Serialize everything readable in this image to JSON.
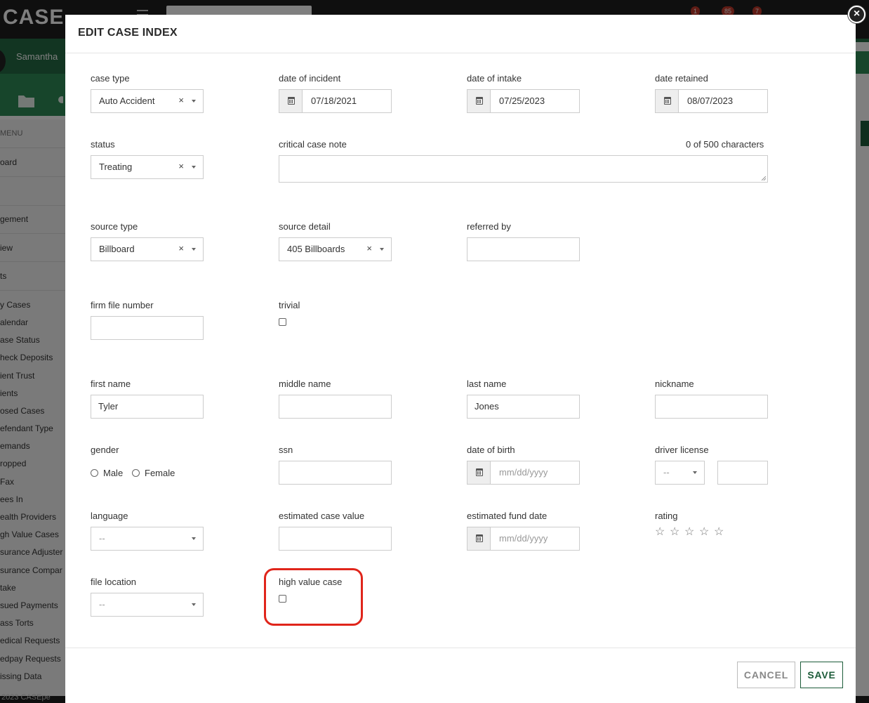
{
  "background": {
    "logo": "CASE",
    "user_name": "Samantha",
    "badges": [
      "1",
      "85",
      "7"
    ],
    "sidebar_menu_label": "MENU",
    "sidebar_items": [
      "oard",
      "gement",
      "iew",
      "ts",
      "y Cases",
      "alendar",
      "ase Status",
      "heck Deposits",
      "ient Trust",
      "ients",
      "osed Cases",
      "efendant Type",
      "emands",
      "ropped",
      "Fax",
      "ees In",
      "ealth Providers",
      "gh Value Cases",
      "surance Adjuster",
      "surance Compar",
      "take",
      "sued Payments",
      "ass Torts",
      "edical Requests",
      "edpay Requests",
      "issing Data"
    ],
    "footer_text": "2023 CASEpe"
  },
  "modal": {
    "title": "EDIT CASE INDEX",
    "close_symbol": "×",
    "fields": {
      "case_type": {
        "label": "case type",
        "value": "Auto Accident",
        "clear": "×"
      },
      "date_of_incident": {
        "label": "date of incident",
        "value": "07/18/2021"
      },
      "date_of_intake": {
        "label": "date of intake",
        "value": "07/25/2023"
      },
      "date_retained": {
        "label": "date retained",
        "value": "08/07/2023"
      },
      "status": {
        "label": "status",
        "value": "Treating",
        "clear": "×"
      },
      "critical_case_note": {
        "label": "critical case note",
        "counter": "0 of 500 characters",
        "value": ""
      },
      "source_type": {
        "label": "source type",
        "value": "Billboard",
        "clear": "×"
      },
      "source_detail": {
        "label": "source detail",
        "value": "405 Billboards",
        "clear": "×"
      },
      "referred_by": {
        "label": "referred by",
        "value": ""
      },
      "firm_file_number": {
        "label": "firm file number",
        "value": ""
      },
      "trivial": {
        "label": "trivial",
        "checked": false
      },
      "first_name": {
        "label": "first name",
        "value": "Tyler"
      },
      "middle_name": {
        "label": "middle name",
        "value": ""
      },
      "last_name": {
        "label": "last name",
        "value": "Jones"
      },
      "nickname": {
        "label": "nickname",
        "value": ""
      },
      "gender": {
        "label": "gender",
        "options": [
          "Male",
          "Female"
        ],
        "selected": null
      },
      "ssn": {
        "label": "ssn",
        "value": ""
      },
      "date_of_birth": {
        "label": "date of birth",
        "placeholder": "mm/dd/yyyy"
      },
      "driver_license": {
        "label": "driver license",
        "state_value": "--",
        "number": ""
      },
      "language": {
        "label": "language",
        "value": "--"
      },
      "estimated_case_value": {
        "label": "estimated case value",
        "value": ""
      },
      "estimated_fund_date": {
        "label": "estimated fund date",
        "placeholder": "mm/dd/yyyy"
      },
      "rating": {
        "label": "rating",
        "stars": 5,
        "filled": 0,
        "star_glyph": "☆"
      },
      "file_location": {
        "label": "file location",
        "value": "--"
      },
      "high_value_case": {
        "label": "high value case",
        "checked": false
      }
    },
    "buttons": {
      "cancel": "CANCEL",
      "save": "SAVE"
    }
  }
}
